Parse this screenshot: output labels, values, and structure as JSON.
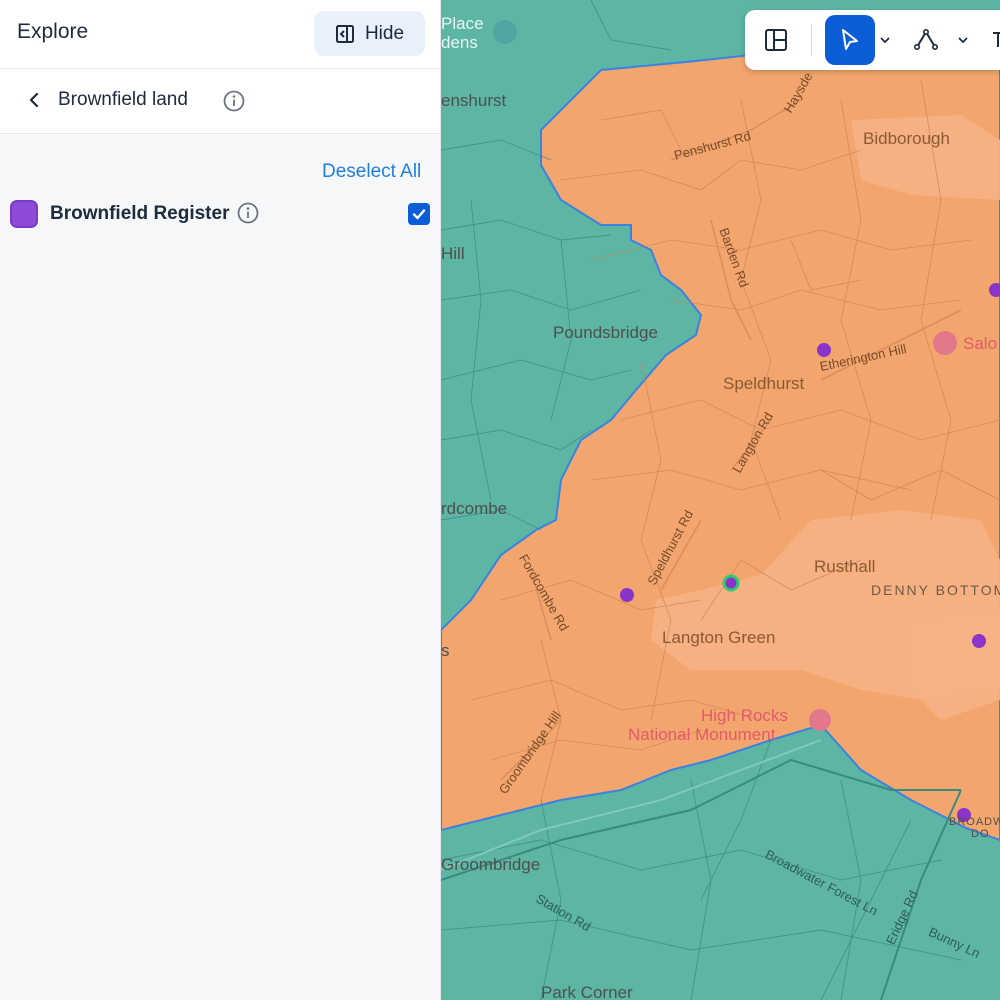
{
  "sidebar": {
    "title": "Explore",
    "hide_label": "Hide",
    "breadcrumb": "Brownfield land",
    "deselect_all": "Deselect All",
    "layers": [
      {
        "label": "Brownfield Register",
        "color": "#8f4bd8",
        "checked": true
      }
    ]
  },
  "map": {
    "labels": {
      "place_gardens": "Place\ndens",
      "penshurst": "enshurst",
      "hill": "Hill",
      "poundsbridge": "Poundsbridge",
      "fordcombe": "rdcombe",
      "bidborough": "Bidborough",
      "speldhurst": "Speldhurst",
      "rusthall": "Rusthall",
      "denny_bottom": "DENNY BOTTOM",
      "langton_green": "Langton Green",
      "high_rocks": "High Rocks",
      "national_monument": "National Monument",
      "groombridge": "Groombridge",
      "park_corner": "Park Corner",
      "salo": "Salo",
      "broadwater": "BROADW",
      "broadwater2": "DO",
      "s_left": "s"
    },
    "roads": {
      "penshurst_rd": "Penshurst Rd",
      "bardon_rd": "Barden Rd",
      "haysden": "Haysde",
      "ferrington": "Etherington Hill",
      "langton_rd": "Langton Rd",
      "speldhurst_rd": "Speldhurst Rd",
      "fordcombe_rd": "Fordcombe Rd",
      "groombridge_hill": "Groombridge Hill",
      "station_rd": "Station Rd",
      "broadwater_forest_ln": "Broadwater Forest Ln",
      "eridge_rd": "Eridge Rd",
      "bunny_ln": "Bunny Ln"
    },
    "colors": {
      "outside": "#5db5a4",
      "inside": "#f2a66d",
      "urban": "#f6ad7d",
      "boundary": "#3d82e0",
      "marker": "#8a35c9",
      "selected_ring": "#2ecc71"
    }
  },
  "toolbar": {
    "tools": [
      "layout-tool",
      "select-tool",
      "draw-tool"
    ]
  }
}
